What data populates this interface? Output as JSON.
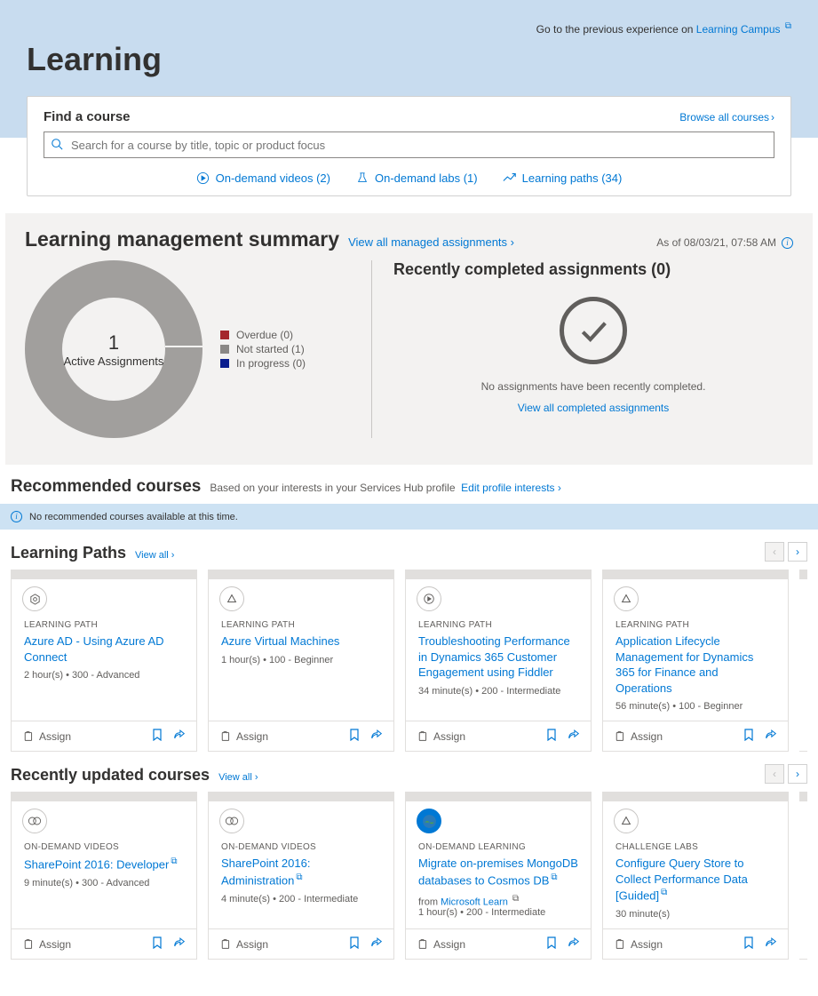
{
  "hero": {
    "previous_text": "Go to the previous experience on ",
    "previous_link": "Learning Campus",
    "title": "Learning"
  },
  "find": {
    "title": "Find a course",
    "browse": "Browse all courses",
    "placeholder": "Search for a course by title, topic or product focus",
    "links": [
      {
        "label": "On-demand videos (2)"
      },
      {
        "label": "On-demand labs (1)"
      },
      {
        "label": "Learning paths (34)"
      }
    ]
  },
  "summary": {
    "title": "Learning management summary",
    "view_all": "View all managed assignments",
    "asof": "As of 08/03/21, 07:58 AM",
    "donut_num": "1",
    "donut_sub": "Active Assignments",
    "legend": [
      {
        "color": "#a4262c",
        "label": "Overdue (0)"
      },
      {
        "color": "#8a8886",
        "label": "Not started (1)"
      },
      {
        "color": "#0b1e8e",
        "label": "In progress (0)"
      }
    ],
    "recent_title": "Recently completed assignments (0)",
    "recent_empty": "No assignments have been recently completed.",
    "recent_link": "View all completed assignments"
  },
  "reco": {
    "title": "Recommended courses",
    "sub": "Based on your interests in your Services Hub profile",
    "edit": "Edit profile interests",
    "banner": "No recommended courses available at this time."
  },
  "paths": {
    "title": "Learning Paths",
    "viewall": "View all",
    "cards": [
      {
        "type": "LEARNING PATH",
        "title": "Azure AD - Using Azure AD Connect",
        "meta": "2 hour(s)  •  300 - Advanced",
        "icon": "hex"
      },
      {
        "type": "LEARNING PATH",
        "title": "Azure Virtual Machines",
        "meta": "1 hour(s)  •  100 - Beginner",
        "icon": "tri"
      },
      {
        "type": "LEARNING PATH",
        "title": "Troubleshooting Performance in Dynamics 365 Customer Engagement using Fiddler",
        "meta": "34 minute(s)  •  200 - Intermediate",
        "icon": "play"
      },
      {
        "type": "LEARNING PATH",
        "title": "Application Lifecycle Management for Dynamics 365 for Finance and Operations",
        "meta": "56 minute(s)  •  100 - Beginner",
        "icon": "tri"
      }
    ]
  },
  "recent": {
    "title": "Recently updated courses",
    "viewall": "View all",
    "cards": [
      {
        "type": "ON-DEMAND VIDEOS",
        "title": "SharePoint 2016: Developer",
        "ext": true,
        "meta": "9 minute(s)  •  300 - Advanced",
        "icon": "overlap"
      },
      {
        "type": "ON-DEMAND VIDEOS",
        "title": "SharePoint 2016: Administration",
        "ext": true,
        "meta": "4 minute(s)  •  200 - Intermediate",
        "icon": "overlap"
      },
      {
        "type": "ON-DEMAND LEARNING",
        "title": "Migrate on-premises MongoDB databases to Cosmos DB",
        "ext": true,
        "from_prefix": "from ",
        "from_link": "Microsoft Learn",
        "from_ext": true,
        "meta": "1 hour(s)  •  200 - Intermediate",
        "icon": "globe"
      },
      {
        "type": "CHALLENGE LABS",
        "title": "Configure Query Store to Collect Performance Data [Guided]",
        "ext": true,
        "meta": "30 minute(s)",
        "icon": "tri"
      }
    ]
  },
  "chart_data": {
    "type": "pie",
    "title": "Active Assignments",
    "total": 1,
    "series": [
      {
        "name": "Overdue",
        "value": 0,
        "color": "#a4262c"
      },
      {
        "name": "Not started",
        "value": 1,
        "color": "#8a8886"
      },
      {
        "name": "In progress",
        "value": 0,
        "color": "#0b1e8e"
      }
    ]
  },
  "common": {
    "assign": "Assign"
  }
}
